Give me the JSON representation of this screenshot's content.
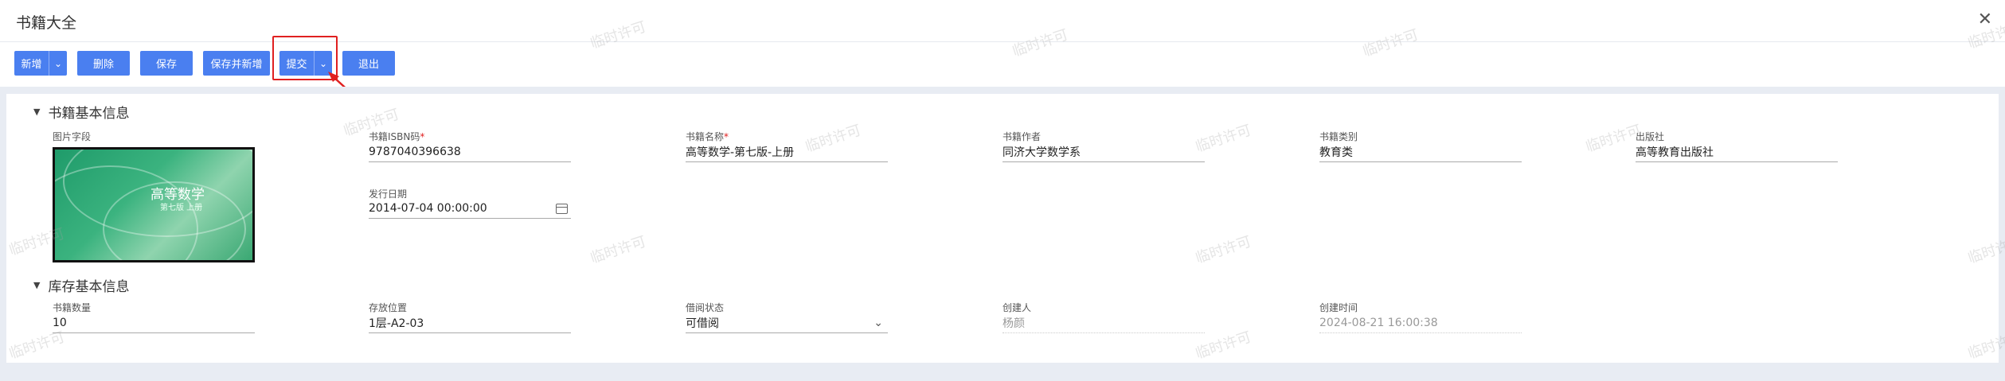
{
  "window": {
    "title": "书籍大全"
  },
  "toolbar": {
    "new_label": "新增",
    "delete_label": "删除",
    "save_label": "保存",
    "save_new_label": "保存并新增",
    "submit_label": "提交",
    "exit_label": "退出"
  },
  "sections": {
    "basic": {
      "title": "书籍基本信息"
    },
    "stock": {
      "title": "库存基本信息"
    }
  },
  "basic_fields": {
    "image": {
      "label": "图片字段"
    },
    "isbn": {
      "label": "书籍ISBN码",
      "value": "9787040396638"
    },
    "name": {
      "label": "书籍名称",
      "value": "高等数学-第七版-上册"
    },
    "author": {
      "label": "书籍作者",
      "value": "同济大学数学系"
    },
    "category": {
      "label": "书籍类别",
      "value": "教育类"
    },
    "publisher": {
      "label": "出版社",
      "value": "高等教育出版社"
    },
    "publish_date": {
      "label": "发行日期",
      "value": "2014-07-04 00:00:00"
    }
  },
  "stock_fields": {
    "quantity": {
      "label": "书籍数量",
      "value": "10"
    },
    "location": {
      "label": "存放位置",
      "value": "1层-A2-03"
    },
    "borrow_status": {
      "label": "借阅状态",
      "value": "可借阅"
    },
    "creator": {
      "label": "创建人",
      "value": "杨颜"
    },
    "created_at": {
      "label": "创建时间",
      "value": "2024-08-21 16:00:38"
    }
  },
  "book_cover": {
    "title": "高等数学",
    "subtitle": "第七版 上册"
  },
  "watermark_text": "临时许可",
  "colors": {
    "primary": "#4a7ff0",
    "highlight": "#e02020",
    "background": "#e8ecf3"
  }
}
